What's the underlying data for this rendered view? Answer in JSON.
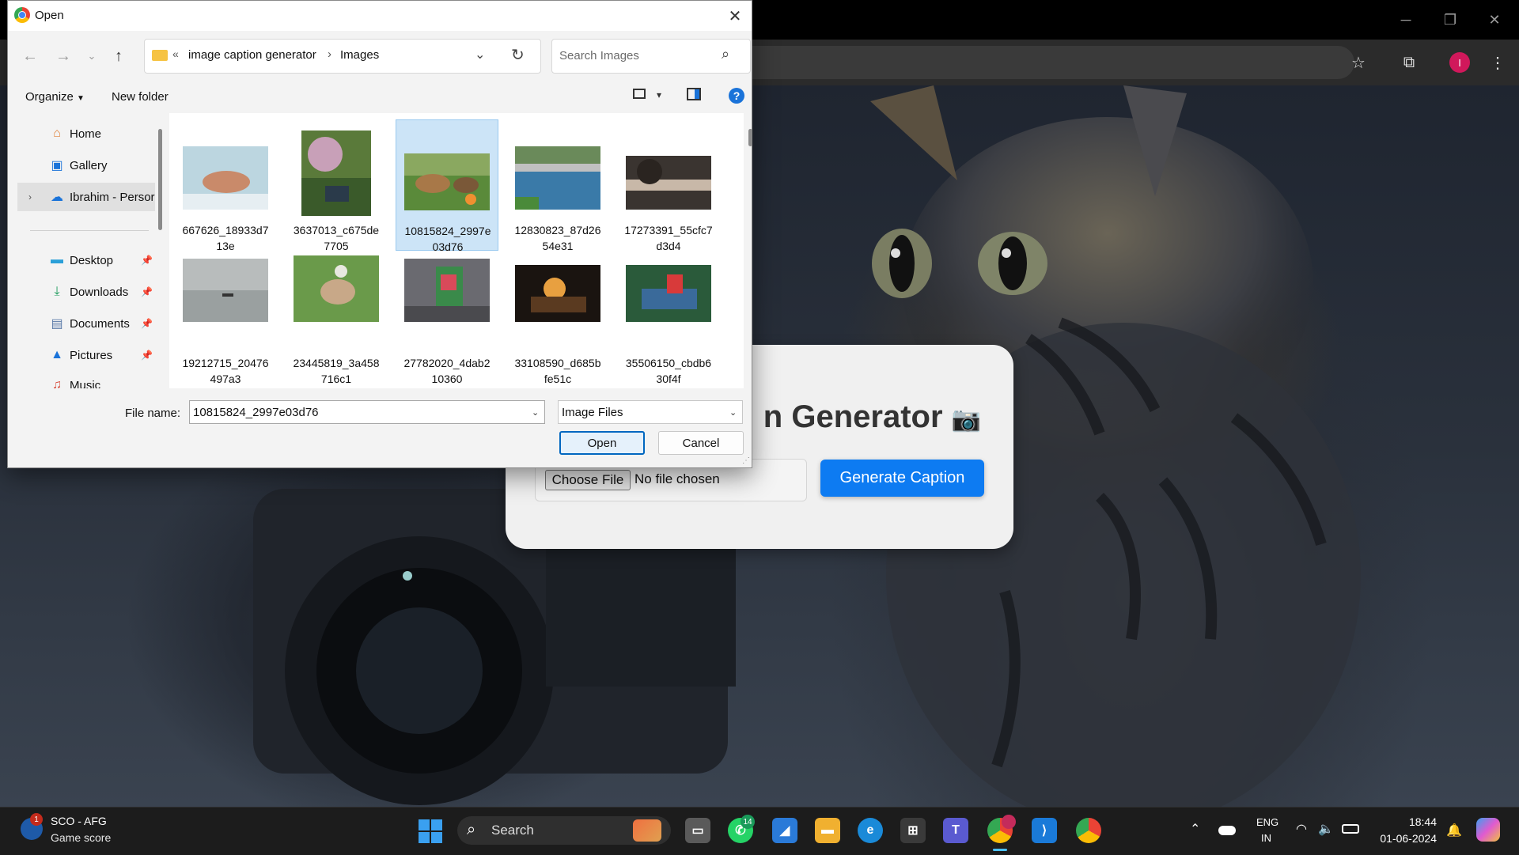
{
  "dialog": {
    "title": "Open",
    "breadcrumb": [
      "image caption generator",
      "Images"
    ],
    "search_placeholder": "Search Images",
    "toolbar": {
      "organize": "Organize",
      "new_folder": "New folder"
    },
    "nav_items": [
      {
        "label": "Home",
        "icon": "home-icon"
      },
      {
        "label": "Gallery",
        "icon": "gallery-icon"
      },
      {
        "label": "Ibrahim - Persor",
        "icon": "onedrive-icon",
        "selected": true
      },
      {
        "label": "Desktop",
        "icon": "desktop-icon",
        "pinned": true
      },
      {
        "label": "Downloads",
        "icon": "download-icon",
        "pinned": true
      },
      {
        "label": "Documents",
        "icon": "documents-icon",
        "pinned": true
      },
      {
        "label": "Pictures",
        "icon": "pictures-icon",
        "pinned": true
      },
      {
        "label": "Music",
        "icon": "music-icon"
      }
    ],
    "files": [
      {
        "name": "667626_18933d713e",
        "line1": "667626_18933d7",
        "line2": "13e"
      },
      {
        "name": "3637013_c675de7705",
        "line1": "3637013_c675de",
        "line2": "7705"
      },
      {
        "name": "10815824_2997e03d76",
        "line1": "10815824_2997e",
        "line2": "03d76",
        "selected": true
      },
      {
        "name": "12830823_87d2654e31",
        "line1": "12830823_87d26",
        "line2": "54e31"
      },
      {
        "name": "17273391_55cfc7d3d4",
        "line1": "17273391_55cfc7",
        "line2": "d3d4"
      },
      {
        "name": "19212715_20476497a3",
        "line1": "19212715_20476",
        "line2": "497a3"
      },
      {
        "name": "23445819_3a458716c1",
        "line1": "23445819_3a458",
        "line2": "716c1"
      },
      {
        "name": "27782020_4dab210360",
        "line1": "27782020_4dab2",
        "line2": "10360"
      },
      {
        "name": "33108590_d685bfe51c",
        "line1": "33108590_d685b",
        "line2": "fe51c"
      },
      {
        "name": "35506150_cbdb630f4f",
        "line1": "35506150_cbdb6",
        "line2": "30f4f"
      }
    ],
    "file_name_label": "File name:",
    "file_name_value": "10815824_2997e03d76",
    "file_type": "Image Files",
    "open_label": "Open",
    "cancel_label": "Cancel"
  },
  "webpage": {
    "title_visible": "n Generator",
    "title_emoji": "📷",
    "choose_file": "Choose File",
    "no_file": "No file chosen",
    "generate": "Generate Caption"
  },
  "chrome": {
    "profile_initial": "I"
  },
  "taskbar": {
    "widget_title": "SCO - AFG",
    "widget_subtitle": "Game score",
    "widget_badge": "1",
    "search_label": "Search",
    "whatsapp_badge": "14",
    "lang_line1": "ENG",
    "lang_line2": "IN",
    "time": "18:44",
    "date": "01-06-2024"
  },
  "colors": {
    "accent_blue": "#0d7bf2",
    "selection_blue": "#cce4f7",
    "profile_pink": "#d0185b"
  }
}
